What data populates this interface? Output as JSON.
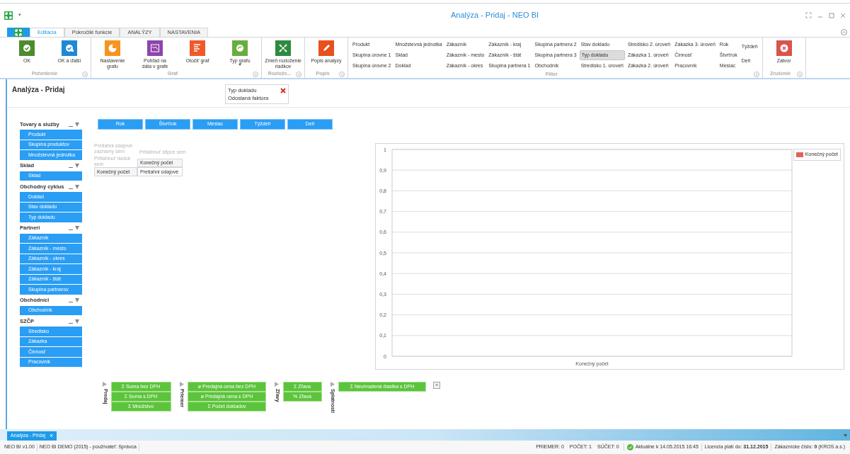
{
  "title_bar": {
    "title": "Analýza - Pridaj - NEO BI",
    "menu_caret": "▾"
  },
  "tabs": [
    {
      "label": "Editácia",
      "selected": true
    },
    {
      "label": "Pokročilé funkcie",
      "selected": false
    },
    {
      "label": "ANALÝZY",
      "selected": false
    },
    {
      "label": "NASTAVENIA",
      "selected": false
    }
  ],
  "ribbon": {
    "groups": [
      {
        "label": "Potvrdenie",
        "kind": "buttons",
        "buttons": [
          {
            "label": "OK",
            "color": "#4e8b2d",
            "dropdown": false
          },
          {
            "label": "OK a ďalší",
            "color": "#1e88d6",
            "dropdown": false
          }
        ]
      },
      {
        "label": "Graf",
        "kind": "buttons",
        "buttons": [
          {
            "label": "Nastavenie grafu",
            "color": "#f7941d",
            "dropdown": false
          },
          {
            "label": "Pohľad na dáta v grafe",
            "color": "#8e44ad",
            "dropdown": false
          },
          {
            "label": "Otočiť graf",
            "color": "#f05a28",
            "dropdown": false
          },
          {
            "label": "Typ grafu",
            "color": "#6aad3d",
            "dropdown": true
          }
        ]
      },
      {
        "label": "Rozlože...",
        "kind": "buttons",
        "buttons": [
          {
            "label": "Zmeň rozloženie riadkov",
            "color": "#2e8b3e",
            "dropdown": false
          }
        ]
      },
      {
        "label": "Popis",
        "kind": "buttons",
        "buttons": [
          {
            "label": "Popis analýzy",
            "color": "#e8501e",
            "dropdown": false
          }
        ]
      },
      {
        "label": "Filter",
        "kind": "filter",
        "columns": [
          [
            {
              "label": "Produkt",
              "selected": false
            },
            {
              "label": "Skupina úrovne 1",
              "selected": false
            },
            {
              "label": "Skupina úrovne 2",
              "selected": false
            }
          ],
          [
            {
              "label": "Množstevná jednotka",
              "selected": false
            },
            {
              "label": "Sklad",
              "selected": false
            },
            {
              "label": "Doklad",
              "selected": false
            }
          ],
          [
            {
              "label": "Zákazník",
              "selected": false
            },
            {
              "label": "Zákazník - mesto",
              "selected": false
            },
            {
              "label": "Zákazník - okres",
              "selected": false
            }
          ],
          [
            {
              "label": "Zákazník - kraj",
              "selected": false
            },
            {
              "label": "Zákazník - štát",
              "selected": false
            },
            {
              "label": "Skupina partnera 1",
              "selected": false
            }
          ],
          [
            {
              "label": "Skupina partnera 2",
              "selected": false
            },
            {
              "label": "Skupina partnera 3",
              "selected": false
            },
            {
              "label": "Obchodník",
              "selected": false
            }
          ],
          [
            {
              "label": "Stav dokladu",
              "selected": false
            },
            {
              "label": "Typ dokladu",
              "selected": true
            },
            {
              "label": "Stredisko 1. úroveň",
              "selected": false
            }
          ],
          [
            {
              "label": "Stredisko 2. úroveň",
              "selected": false
            },
            {
              "label": "Zákazka 1. úroveň",
              "selected": false
            },
            {
              "label": "Zákazka 2. úroveň",
              "selected": false
            }
          ],
          [
            {
              "label": "Zákazka 3. úroveň",
              "selected": false
            },
            {
              "label": "Činnosť",
              "selected": false
            },
            {
              "label": "Pracovník",
              "selected": false
            }
          ],
          [
            {
              "label": "Rok",
              "selected": false
            },
            {
              "label": "Štvrťrok",
              "selected": false
            },
            {
              "label": "Mesiac",
              "selected": false
            }
          ],
          [
            {
              "label": "Týždeň",
              "selected": false
            },
            {
              "label": "Deň",
              "selected": false
            }
          ]
        ]
      },
      {
        "label": "Zrušenie",
        "kind": "buttons",
        "buttons": [
          {
            "label": "Zatvor",
            "color": "#d9534f",
            "dropdown": false
          }
        ]
      }
    ]
  },
  "analysis": {
    "title": "Analýza - Pridaj",
    "active_filter": {
      "field": "Typ dokladu",
      "value": "Odoslaná faktúra"
    }
  },
  "field_list": [
    {
      "title": "Tovary a služby",
      "items": [
        "Produkt",
        "Skupina produktov",
        "Množstevná jednotka"
      ]
    },
    {
      "title": "Sklad",
      "items": [
        "Sklad"
      ]
    },
    {
      "title": "Obchodný cyklus",
      "items": [
        "Doklad",
        "Stav dokladu",
        "Typ dokladu"
      ]
    },
    {
      "title": "Partneri",
      "items": [
        "Zákazník",
        "Zákazník - mesto",
        "Zákazník - okres",
        "Zákazník - kraj",
        "Zákazník - štát",
        "Skupina partnerov"
      ]
    },
    {
      "title": "Obchodníci",
      "items": [
        "Obchodník"
      ]
    },
    {
      "title": "SZČP",
      "items": [
        "Stredisko",
        "Zákazka",
        "Činnosť",
        "Pracovník"
      ]
    }
  ],
  "column_fields": [
    "Rok",
    "Štvrťrok",
    "Mesiac",
    "Týždeň",
    "Deň"
  ],
  "pivot": {
    "data_drop_hint": "Pretiahni údajové záznamy sem",
    "row_drop_hint": "Pritiahnuť riadok sem",
    "column_drop_hint": "Pritiahnuť stĺpce sem",
    "column_header": "Konečný počet",
    "row_header": "Konečný počet",
    "data_cell": "Pretiahni údajové"
  },
  "chart": {
    "chart_data": {
      "type": "bar",
      "grid": true,
      "categories": [
        "Konečný počet"
      ],
      "series": [
        {
          "name": "Konečný počet",
          "color": "#e2635a",
          "values": [
            null
          ]
        }
      ],
      "ylim": [
        0,
        1
      ],
      "yticks": [
        {
          "value": 0,
          "label": "0"
        },
        {
          "value": 0.1,
          "label": "0,1"
        },
        {
          "value": 0.2,
          "label": "0,2"
        },
        {
          "value": 0.3,
          "label": "0,3"
        },
        {
          "value": 0.4,
          "label": "0,4"
        },
        {
          "value": 0.5,
          "label": "0,5"
        },
        {
          "value": 0.6,
          "label": "0,6"
        },
        {
          "value": 0.7,
          "label": "0,7"
        },
        {
          "value": 0.8,
          "label": "0,8"
        },
        {
          "value": 0.9,
          "label": "0,9"
        },
        {
          "value": 1,
          "label": "1"
        }
      ]
    }
  },
  "measure_groups": [
    {
      "title": "Predaj",
      "items": [
        "Σ Suma bez DPH",
        "Σ Suma s DPH",
        "Σ Množstvo"
      ]
    },
    {
      "title": "Priemer",
      "items": [
        "ø Predajná cena bez DPH",
        "ø Predajná cena s DPH",
        "Σ Počet dokladov"
      ]
    },
    {
      "title": "Zľavy",
      "items": [
        "Σ Zľava",
        "% Zľava"
      ]
    },
    {
      "title": "Splatnosti",
      "items": [
        "Σ Neuhradená čiastka s DPH"
      ]
    }
  ],
  "add_button": "+",
  "document_tabs": [
    {
      "label": "Analýza - Pridaj",
      "close": "×",
      "selected": true
    }
  ],
  "status_bar": {
    "left": [
      "NEO BI v1.00",
      "NEO BI DEMO (2015) - používateľ: Správca"
    ],
    "stats": [
      "PRIEMER: 0",
      "POČET: 1",
      "SÚČET: 0"
    ],
    "updated": "Aktuálne k 14.05.2015 16:45",
    "license": "Licencia platí do: **31.12.2015**",
    "customer": "Zákaznícke číslo: **0** (KROS a.s.)"
  }
}
